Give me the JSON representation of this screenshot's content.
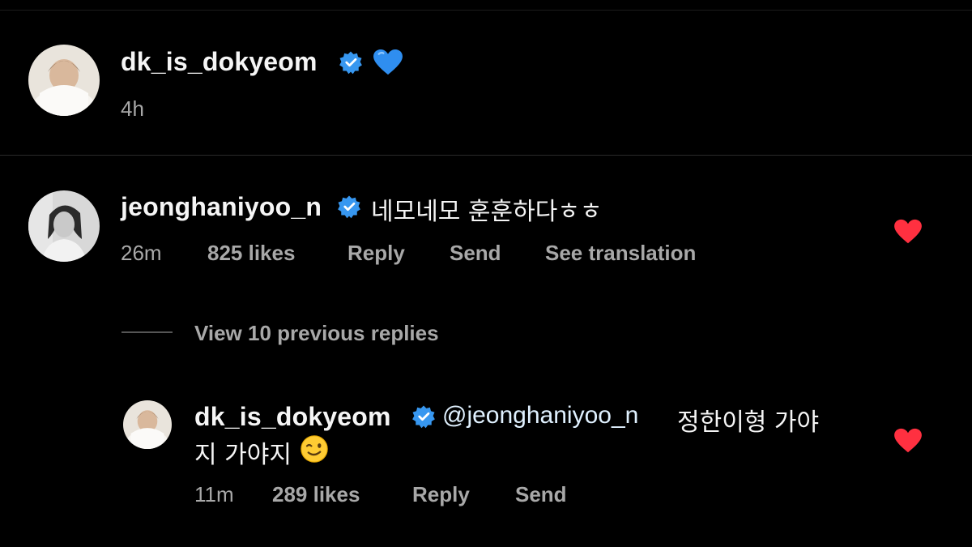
{
  "caption": {
    "username": "dk_is_dokyeom",
    "emoji": "blue-heart",
    "time": "4h"
  },
  "comment": {
    "username": "jeonghaniyoo_n",
    "text": "네모네모 훈훈하다ㅎㅎ",
    "time": "26m",
    "likes": "825 likes",
    "reply_label": "Reply",
    "send_label": "Send",
    "translate_label": "See translation",
    "liked": true
  },
  "view_replies_label": "View 10 previous replies",
  "reply": {
    "username": "dk_is_dokyeom",
    "mention": "@jeonghaniyoo_n",
    "text_line1": "정한이형 가야",
    "text_line2": "지 가야지",
    "emoji": "winking-face",
    "time": "11m",
    "likes": "289 likes",
    "reply_label": "Reply",
    "send_label": "Send",
    "liked": true
  },
  "colors": {
    "background": "#000000",
    "verified": "#3797f0",
    "liked_heart": "#ff3040",
    "secondary_text": "#a8a8a8",
    "mention": "#e0f1ff"
  }
}
